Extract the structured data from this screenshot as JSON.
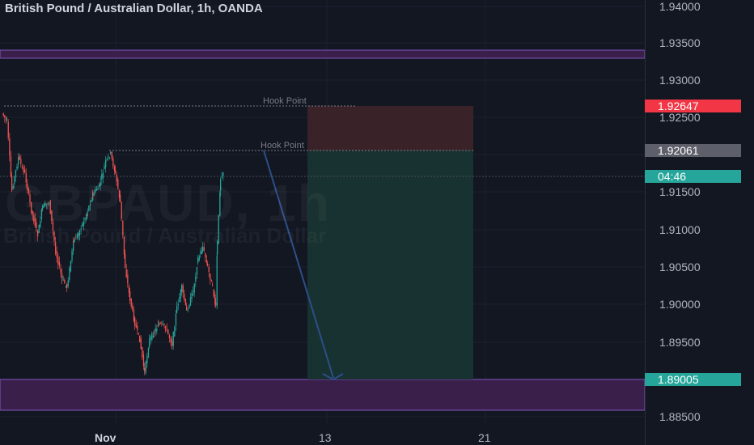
{
  "header": {
    "symbol_title": "British Pound / Australian Dollar, 1h, OANDA"
  },
  "watermark": {
    "ticker": "GBPAUD, 1h",
    "description": "British Pound / Australian Dollar"
  },
  "price_axis": {
    "ticks": [
      "1.94000",
      "1.93500",
      "1.93000",
      "1.92500",
      "1.91500",
      "1.91000",
      "1.90500",
      "1.90000",
      "1.89500",
      "1.88500"
    ]
  },
  "time_axis": {
    "labels": [
      "Nov",
      "13",
      "21"
    ]
  },
  "badges": {
    "stop_price": "1.92647",
    "entry_price": "1.92061",
    "countdown": "04:46",
    "target_price": "1.89005"
  },
  "annotations": {
    "hook_point_upper": "Hook Point",
    "hook_point_lower": "Hook Point"
  },
  "colors": {
    "background": "#131722",
    "bull": "#26a69a",
    "bear": "#ef5350",
    "zone": "#3a1f4a",
    "stop_zone": "#3a2328",
    "target_zone": "#173230",
    "arrow": "#2d4e8a",
    "countdown_badge": "#26a69a",
    "stop_badge": "#f23645",
    "entry_badge": "#5d606b"
  }
}
